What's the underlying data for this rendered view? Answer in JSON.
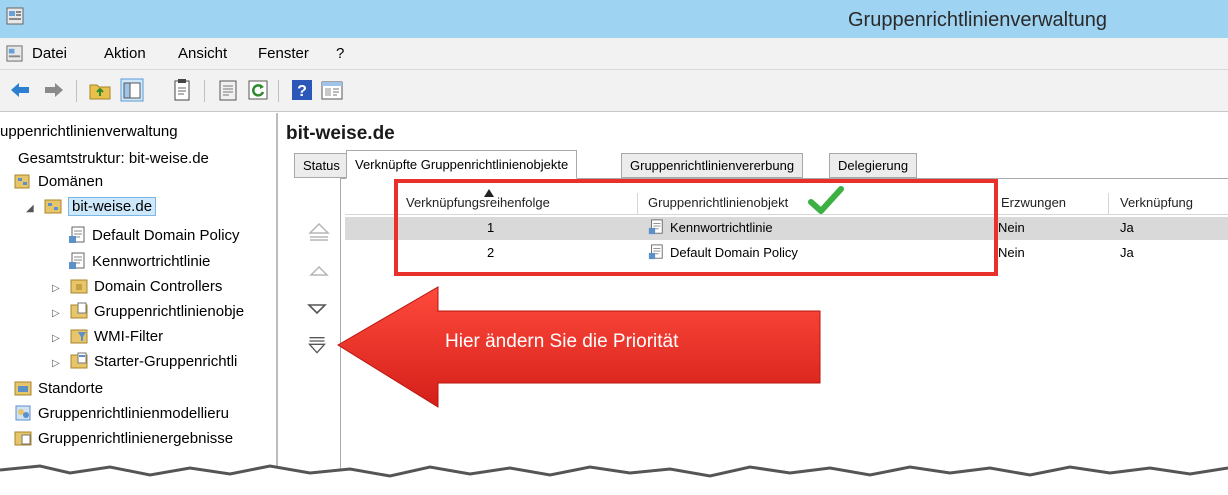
{
  "window": {
    "title": "Gruppenrichtlinienverwaltung"
  },
  "menu": {
    "items": [
      "Datei",
      "Aktion",
      "Ansicht",
      "Fenster",
      "?"
    ]
  },
  "toolbar": {
    "icons": [
      "back-icon",
      "forward-icon",
      "up-folder-icon",
      "show-tree-icon",
      "clipboard-icon",
      "properties-icon",
      "refresh-icon",
      "help-icon",
      "console-icon"
    ]
  },
  "tree": {
    "root": "uppenrichtlinienverwaltung",
    "forest": "Gesamtstruktur: bit-weise.de",
    "domains": "Domänen",
    "domain": "bit-weise.de",
    "children": [
      "Default Domain Policy",
      "Kennwortrichtlinie",
      "Domain Controllers",
      "Gruppenrichtlinienobjе",
      "WMI-Filter",
      "Starter-Gruppenrichtli"
    ],
    "sites": "Standorte",
    "modeling": "Gruppenrichtlinienmodellieru",
    "results": "Gruppenrichtlinienergebnisse"
  },
  "content": {
    "heading": "bit-weise.de",
    "tabs": [
      "Status",
      "Verknüpfte Gruppenrichtlinienobjekte",
      "Gruppenrichtlinienvererbung",
      "Delegierung"
    ],
    "active_tab": "Verknüpfte Gruppenrichtlinienobjekte",
    "columns": [
      "Verknüpfungsreihenfolge",
      "Gruppenrichtlinienobjekt",
      "Erzwungen",
      "Verknüpfung"
    ],
    "rows": [
      {
        "order": "1",
        "gpo": "Kennwortrichtlinie",
        "enforced": "Nein",
        "link": "Ja"
      },
      {
        "order": "2",
        "gpo": "Default Domain Policy",
        "enforced": "Nein",
        "link": "Ja"
      }
    ]
  },
  "callout": {
    "text": "Hier ändern Sie die Priorität",
    "color": "#e8312b"
  },
  "colors": {
    "titlebar": "#9fd3f2",
    "selection": "#cde8fb",
    "highlight": "#e8312b",
    "checkmark": "#3cb043"
  }
}
